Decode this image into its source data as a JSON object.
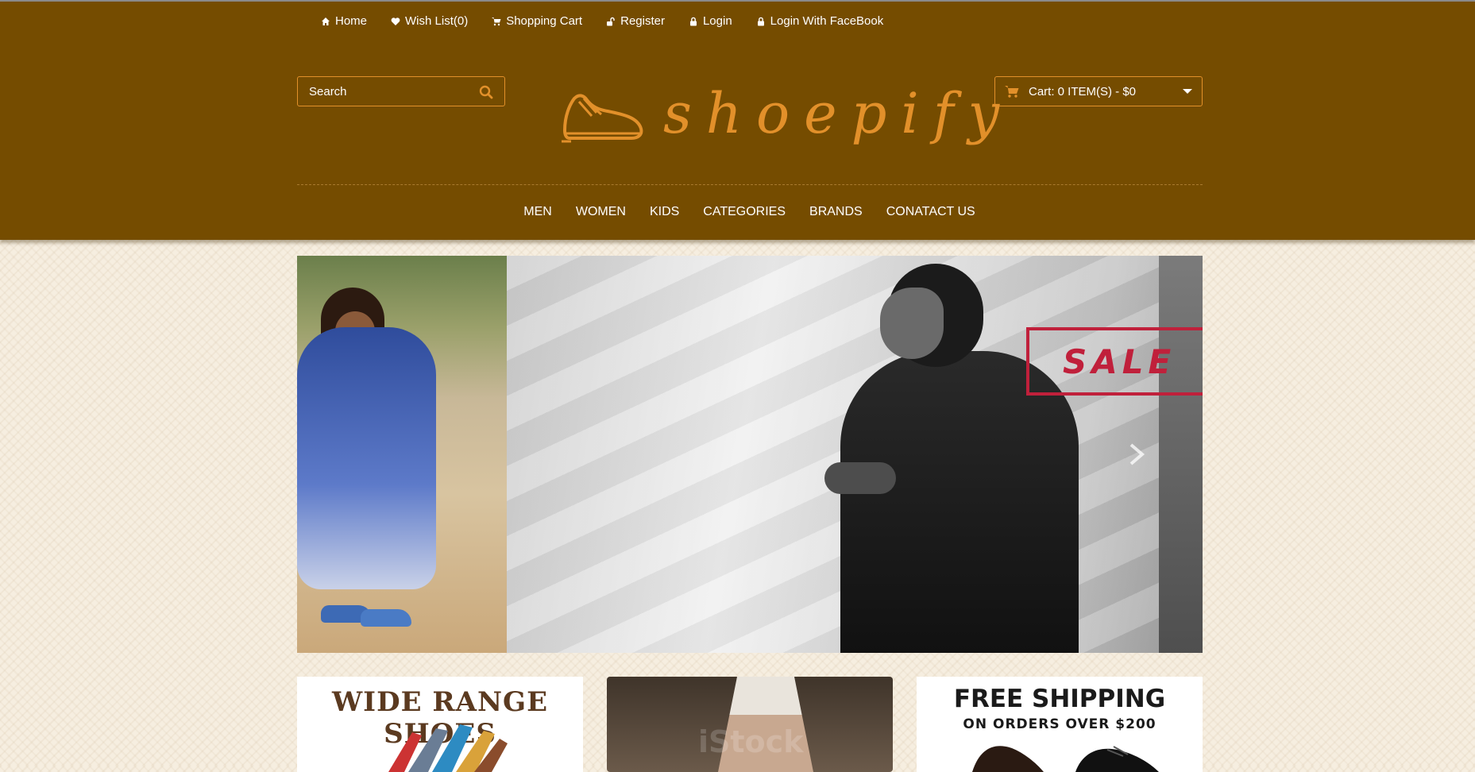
{
  "top_links": [
    {
      "label": "Home",
      "icon": "home-icon"
    },
    {
      "label": "Wish List(0)",
      "icon": "heart-icon"
    },
    {
      "label": "Shopping Cart",
      "icon": "cart-icon"
    },
    {
      "label": "Register",
      "icon": "unlock-icon"
    },
    {
      "label": "Login",
      "icon": "lock-icon"
    },
    {
      "label": "Login With FaceBook",
      "icon": "lock-icon"
    }
  ],
  "search": {
    "placeholder": "Search"
  },
  "logo": {
    "text": "shoepify"
  },
  "cart": {
    "label": "Cart: 0 ITEM(S) - $0"
  },
  "main_nav": [
    "MEN",
    "WOMEN",
    "KIDS",
    "CATEGORIES",
    "BRANDS",
    "CONATACT US"
  ],
  "slider": {
    "badge": "SALE"
  },
  "promos": {
    "wide_range": "WIDE RANGE SHOES",
    "watermark": "iStock",
    "free_shipping_title": "FREE SHIPPING",
    "free_shipping_sub": "ON ORDERS OVER $200"
  },
  "colors": {
    "header_bg": "#754c00",
    "accent": "#e2902a",
    "page_bg": "#f6eee0",
    "sale": "#c0203b"
  }
}
